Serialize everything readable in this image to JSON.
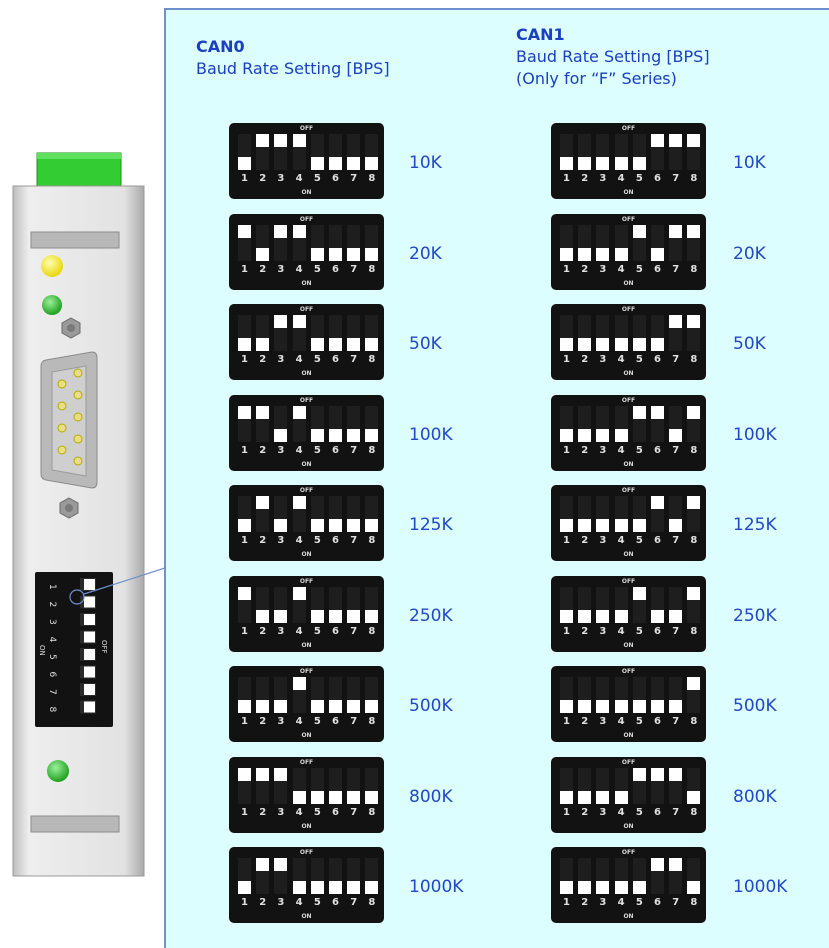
{
  "can0": {
    "title": "CAN0",
    "subtitle": "Baud Rate Setting [BPS]"
  },
  "can1": {
    "title": "CAN1",
    "subtitle": "Baud Rate Setting [BPS]",
    "note": "(Only for “F” Series)"
  },
  "switch_text": {
    "off": "OFF",
    "on": "ON",
    "numbers": [
      "1",
      "2",
      "3",
      "4",
      "5",
      "6",
      "7",
      "8"
    ]
  },
  "device_switch": {
    "off": "OFF",
    "on": "ON",
    "numbers": [
      "1",
      "2",
      "3",
      "4",
      "5",
      "6",
      "7",
      "8"
    ]
  },
  "rows": [
    {
      "label": "10K",
      "can0": [
        0,
        1,
        1,
        1,
        0,
        0,
        0,
        0
      ],
      "can1": [
        0,
        0,
        0,
        0,
        0,
        1,
        1,
        1
      ]
    },
    {
      "label": "20K",
      "can0": [
        1,
        0,
        1,
        1,
        0,
        0,
        0,
        0
      ],
      "can1": [
        0,
        0,
        0,
        0,
        1,
        0,
        1,
        1
      ]
    },
    {
      "label": "50K",
      "can0": [
        0,
        0,
        1,
        1,
        0,
        0,
        0,
        0
      ],
      "can1": [
        0,
        0,
        0,
        0,
        0,
        0,
        1,
        1
      ]
    },
    {
      "label": "100K",
      "can0": [
        1,
        1,
        0,
        1,
        0,
        0,
        0,
        0
      ],
      "can1": [
        0,
        0,
        0,
        0,
        1,
        1,
        0,
        1
      ]
    },
    {
      "label": "125K",
      "can0": [
        0,
        1,
        0,
        1,
        0,
        0,
        0,
        0
      ],
      "can1": [
        0,
        0,
        0,
        0,
        0,
        1,
        0,
        1
      ]
    },
    {
      "label": "250K",
      "can0": [
        1,
        0,
        0,
        1,
        0,
        0,
        0,
        0
      ],
      "can1": [
        0,
        0,
        0,
        0,
        1,
        0,
        0,
        1
      ]
    },
    {
      "label": "500K",
      "can0": [
        0,
        0,
        0,
        1,
        0,
        0,
        0,
        0
      ],
      "can1": [
        0,
        0,
        0,
        0,
        0,
        0,
        0,
        1
      ]
    },
    {
      "label": "800K",
      "can0": [
        1,
        1,
        1,
        0,
        0,
        0,
        0,
        0
      ],
      "can1": [
        0,
        0,
        0,
        0,
        1,
        1,
        1,
        0
      ]
    },
    {
      "label": "1000K",
      "can0": [
        0,
        1,
        1,
        0,
        0,
        0,
        0,
        0
      ],
      "can1": [
        0,
        0,
        0,
        0,
        0,
        1,
        1,
        0
      ]
    }
  ],
  "colors": {
    "panel": "#dcfefe",
    "panel_border": "#6f8fcf",
    "text": "#1a3fbf",
    "led_yellow": "#f2e400",
    "led_green": "#1fb51f",
    "terminal": "#33cc33",
    "housing": "#e4e4e4",
    "switch_body": "#121212",
    "knob": "#ffffff"
  }
}
